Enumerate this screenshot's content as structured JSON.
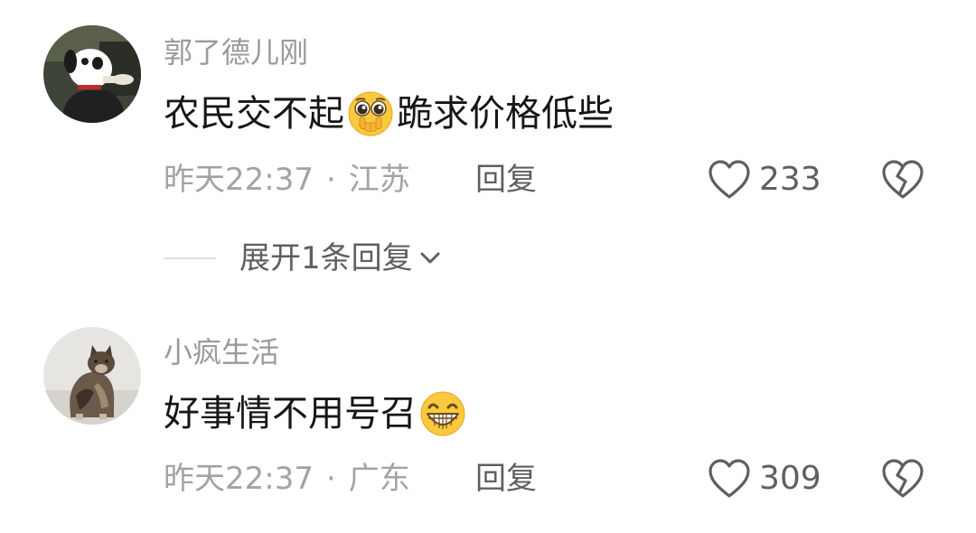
{
  "comments": [
    {
      "username": "郭了德儿刚",
      "text_before": "农民交不起",
      "emoji": "pleading-face-icon",
      "text_after": "跪求价格低些",
      "time": "昨天22:37",
      "separator": "·",
      "location": "江苏",
      "reply_label": "回复",
      "likes": "233",
      "expand_replies": "展开1条回复"
    },
    {
      "username": "小疯生活",
      "text_before": "好事情不用号召",
      "emoji": "grinning-face-icon",
      "text_after": "",
      "time": "昨天22:37",
      "separator": "·",
      "location": "广东",
      "reply_label": "回复",
      "likes": "309"
    }
  ],
  "colors": {
    "username": "#9a9a9a",
    "body": "#161616",
    "meta": "#a3a3a3",
    "action": "#5f5f5f",
    "emoji_yellow": "#fbc93e"
  }
}
